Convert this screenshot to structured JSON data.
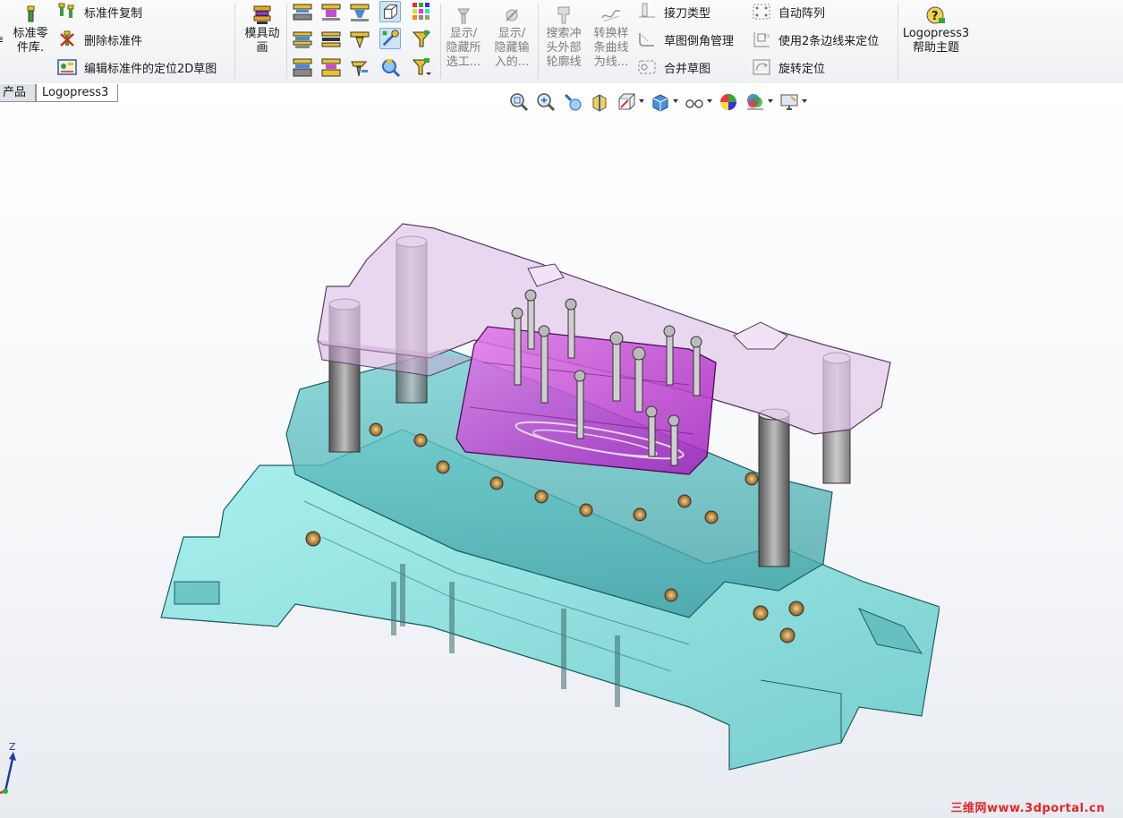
{
  "ribbon": {
    "std_library": {
      "label": "标准零\n件库."
    },
    "small_buttons": {
      "copy": "标准件复制",
      "delete": "删除标准件",
      "edit_position": "编辑标准件的定位2D草图"
    },
    "die_animation": {
      "label": "模具动\n画"
    },
    "show_hide_selected": {
      "label": "显示/\n隐藏所\n选工..."
    },
    "show_hide_input": {
      "label": "显示/\n隐藏输\n入的..."
    },
    "search_punch": {
      "label": "搜索冲\n头外部\n轮廓线"
    },
    "convert_spline": {
      "label": "转换样\n条曲线\n为线..."
    },
    "right_list_1": {
      "knife_type": "接刀类型",
      "sketch_fillet": "草图倒角管理",
      "merge_sketch": "合并草图"
    },
    "right_list_2": {
      "auto_array": "自动阵列",
      "two_edge_position": "使用2条边线来定位",
      "rotate_position": "旋转定位"
    },
    "help": {
      "label": "Logopress3\n帮助主题"
    }
  },
  "tabs": [
    {
      "label": "产品"
    },
    {
      "label": "Logopress3"
    }
  ],
  "viewtools": [
    {
      "icon": "zoom-to-fit-icon"
    },
    {
      "icon": "zoom-area-icon"
    },
    {
      "icon": "previous-view-icon"
    },
    {
      "icon": "section-view-icon"
    },
    {
      "icon": "view-orientation-icon"
    },
    {
      "icon": "display-style-icon"
    },
    {
      "icon": "hide-show-items-icon"
    },
    {
      "icon": "edit-appearance-icon"
    },
    {
      "icon": "apply-scene-icon"
    },
    {
      "icon": "view-settings-icon"
    }
  ],
  "triad": {
    "axis_label": "Z"
  },
  "watermark": "三维网www.3dportal.cn",
  "colors": {
    "cyan_plate": "#7fdad8",
    "magenta_punch": "#c238d6",
    "lavender_top": "#e2c7ea",
    "pillar_gray": "#7f7f7f"
  }
}
